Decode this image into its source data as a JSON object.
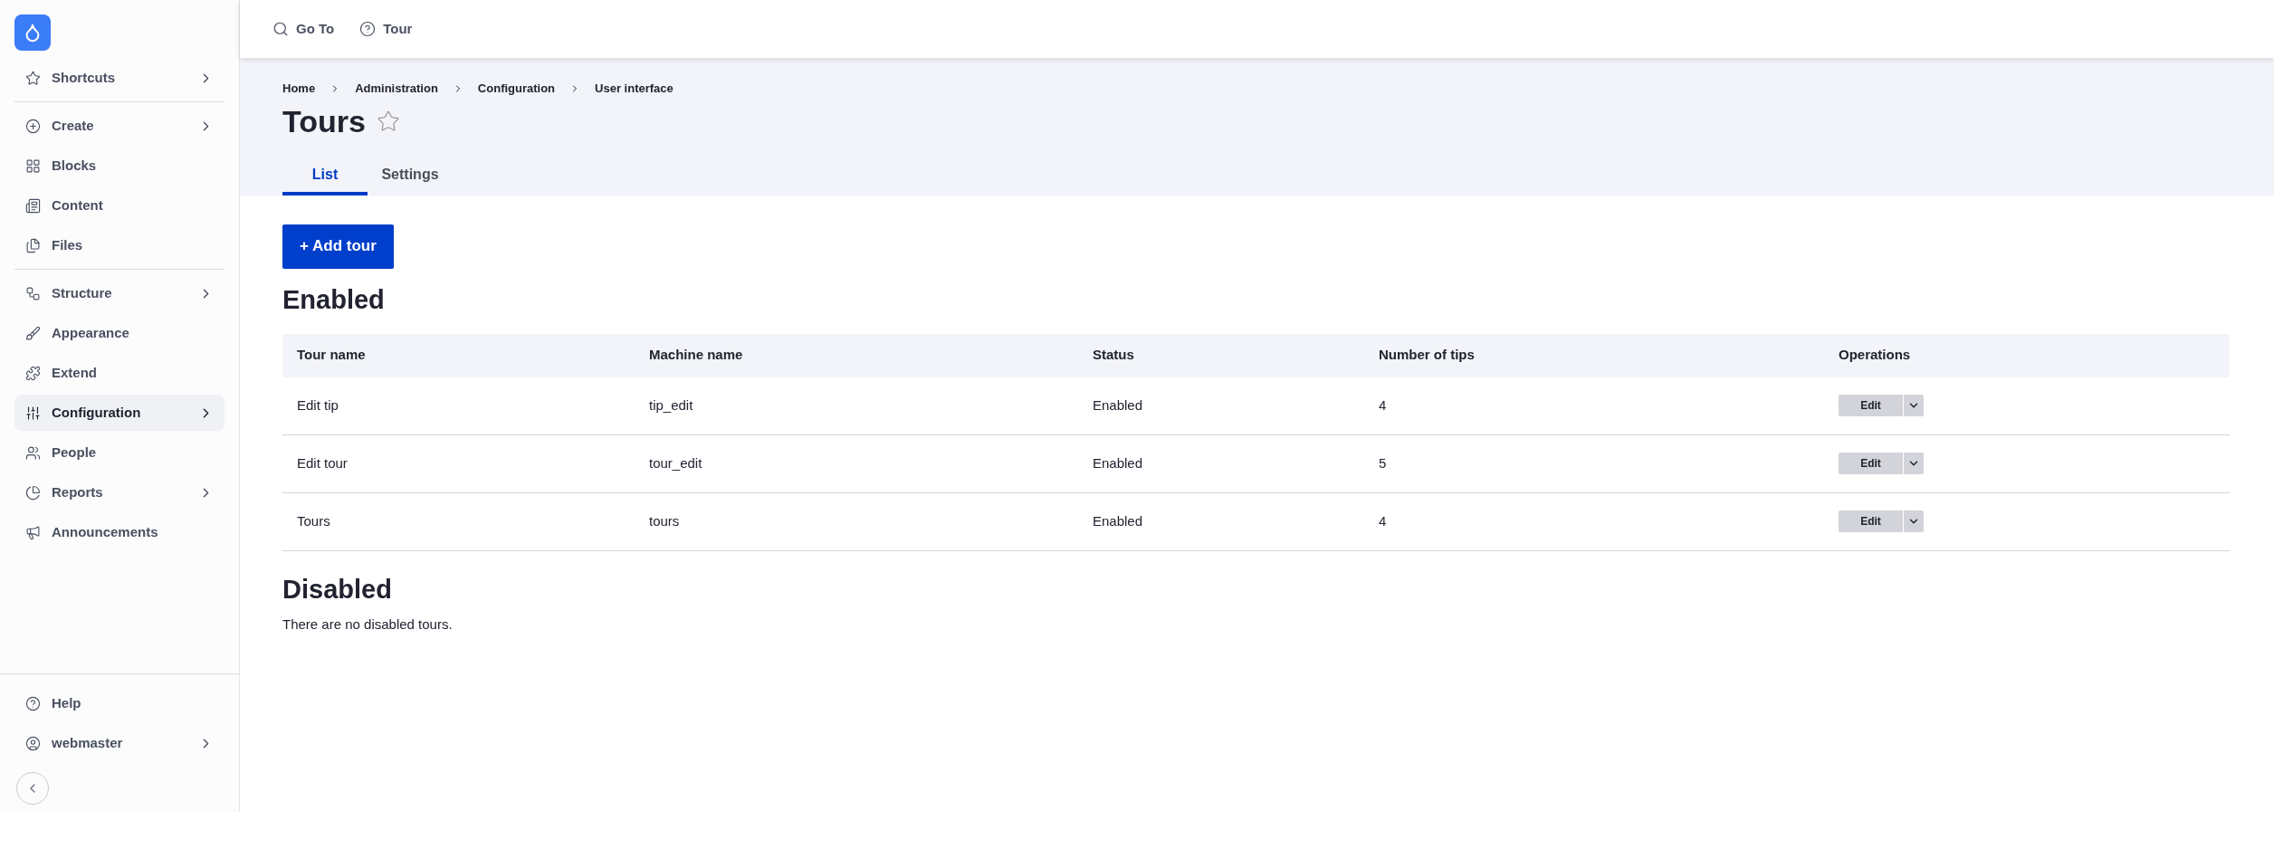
{
  "sidebar": {
    "groups": [
      [
        {
          "label": "Shortcuts",
          "has_children": true,
          "selected": false
        }
      ],
      [
        {
          "label": "Create",
          "has_children": true,
          "selected": false
        },
        {
          "label": "Blocks",
          "has_children": false,
          "selected": false
        },
        {
          "label": "Content",
          "has_children": false,
          "selected": false
        },
        {
          "label": "Files",
          "has_children": false,
          "selected": false
        }
      ],
      [
        {
          "label": "Structure",
          "has_children": true,
          "selected": false
        },
        {
          "label": "Appearance",
          "has_children": false,
          "selected": false
        },
        {
          "label": "Extend",
          "has_children": false,
          "selected": false
        },
        {
          "label": "Configuration",
          "has_children": true,
          "selected": true
        },
        {
          "label": "People",
          "has_children": false,
          "selected": false
        },
        {
          "label": "Reports",
          "has_children": true,
          "selected": false
        },
        {
          "label": "Announcements",
          "has_children": false,
          "selected": false
        }
      ]
    ],
    "footer": [
      {
        "label": "Help",
        "has_children": false,
        "selected": false
      },
      {
        "label": "webmaster",
        "has_children": true,
        "selected": false
      }
    ]
  },
  "toolbar": [
    {
      "label": "Go To"
    },
    {
      "label": "Tour"
    }
  ],
  "breadcrumb": [
    "Home",
    "Administration",
    "Configuration",
    "User interface"
  ],
  "title": "Tours",
  "tabs": [
    {
      "label": "List",
      "selected": true
    },
    {
      "label": "Settings",
      "selected": false
    }
  ],
  "add_button": "+ Add tour",
  "enabled": {
    "heading": "Enabled",
    "columns": [
      "Tour name",
      "Machine name",
      "Status",
      "Number of tips",
      "Operations"
    ],
    "rows": [
      {
        "name": "Edit tip",
        "machine": "tip_edit",
        "status": "Enabled",
        "tips": "4",
        "operation": "Edit"
      },
      {
        "name": "Edit tour",
        "machine": "tour_edit",
        "status": "Enabled",
        "tips": "5",
        "operation": "Edit"
      },
      {
        "name": "Tours",
        "machine": "tours",
        "status": "Enabled",
        "tips": "4",
        "operation": "Edit"
      }
    ]
  },
  "disabled": {
    "heading": "Disabled",
    "empty_text": "There are no disabled tours."
  }
}
